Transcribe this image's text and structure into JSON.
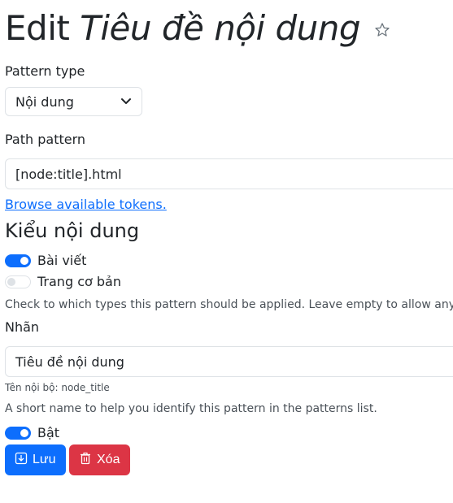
{
  "header": {
    "title_prefix": "Edit",
    "title_name": "Tiêu đề nội dung",
    "star_icon": "star-outline-icon"
  },
  "pattern_type": {
    "label": "Pattern type",
    "selected": "Nội dung",
    "chevron_icon": "chevron-down-icon"
  },
  "path_pattern": {
    "label": "Path pattern",
    "value": "[node:title].html",
    "tokens_link": "Browse available tokens."
  },
  "content_types": {
    "heading": "Kiểu nội dung",
    "items": [
      {
        "label": "Bài viết",
        "checked": true
      },
      {
        "label": "Trang cơ bản",
        "checked": false
      }
    ],
    "help": "Check to which types this pattern should be applied. Leave empty to allow any."
  },
  "label_field": {
    "label": "Nhãn",
    "value": "Tiêu đề nội dung",
    "machine_name": "Tên nội bộ: node_title",
    "help": "A short name to help you identify this pattern in the patterns list."
  },
  "enabled": {
    "label": "Bật",
    "checked": true
  },
  "actions": {
    "save_label": "Lưu",
    "save_icon": "download-icon",
    "delete_label": "Xóa",
    "delete_icon": "trash-icon"
  },
  "colors": {
    "primary": "#0d6efd",
    "danger": "#dc3545",
    "link": "#0d6efd",
    "border": "#dee2e6"
  }
}
